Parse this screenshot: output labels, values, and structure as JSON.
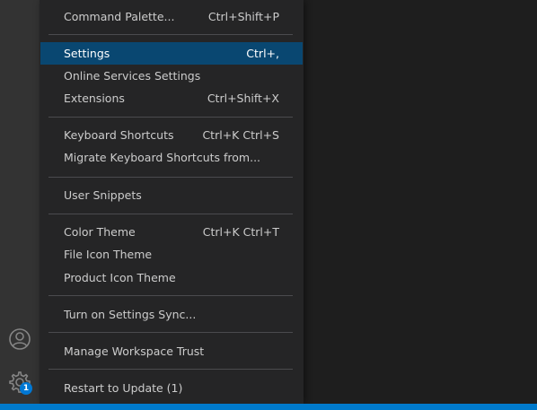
{
  "activity_bar": {
    "icons": [
      {
        "name": "accounts-icon"
      },
      {
        "name": "manage-gear-icon",
        "badge": "1"
      }
    ]
  },
  "menu": {
    "items": [
      {
        "label": "Command Palette...",
        "keybinding": "Ctrl+Shift+P"
      },
      {
        "label": "Settings",
        "keybinding": "Ctrl+,",
        "active": true
      },
      {
        "label": "Online Services Settings",
        "keybinding": ""
      },
      {
        "label": "Extensions",
        "keybinding": "Ctrl+Shift+X"
      },
      {
        "label": "Keyboard Shortcuts",
        "keybinding": "Ctrl+K Ctrl+S"
      },
      {
        "label": "Migrate Keyboard Shortcuts from...",
        "keybinding": ""
      },
      {
        "label": "User Snippets",
        "keybinding": ""
      },
      {
        "label": "Color Theme",
        "keybinding": "Ctrl+K Ctrl+T"
      },
      {
        "label": "File Icon Theme",
        "keybinding": ""
      },
      {
        "label": "Product Icon Theme",
        "keybinding": ""
      },
      {
        "label": "Turn on Settings Sync...",
        "keybinding": ""
      },
      {
        "label": "Manage Workspace Trust",
        "keybinding": ""
      },
      {
        "label": "Restart to Update (1)",
        "keybinding": ""
      }
    ]
  },
  "colors": {
    "menu_bg": "#252526",
    "active_bg": "#094771",
    "status_bar": "#007acc",
    "badge": "#0078d4"
  }
}
